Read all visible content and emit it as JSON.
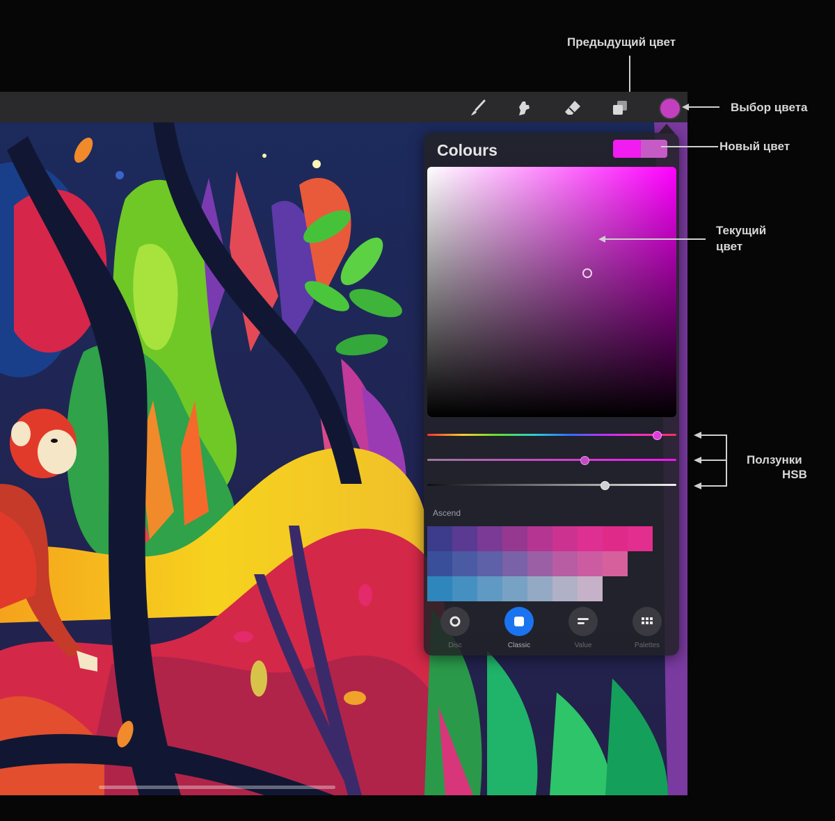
{
  "annotations": {
    "previous_color": "Предыдущий цвет",
    "color_picker": "Выбор цвета",
    "new_color": "Новый цвет",
    "current_color_line1": "Текущий",
    "current_color_line2": "цвет",
    "hsb_line1": "Ползунки",
    "hsb_line2": "HSB"
  },
  "toolbar": {
    "icons": [
      "brush-icon",
      "smudge-icon",
      "eraser-icon",
      "layers-icon"
    ],
    "current_color": "#c43fbf"
  },
  "panel": {
    "title": "Colours",
    "previous_swatch_color": "#f01cf0",
    "new_swatch_color": "#c65bc6",
    "palette_name": "Ascend",
    "palette_rows": [
      [
        "#3d3b8c",
        "#5a3a92",
        "#7a3a96",
        "#96388f",
        "#b43592",
        "#cc3390",
        "#dd3092",
        "#e02a8a",
        "#e22e8e"
      ],
      [
        "#3a4f9a",
        "#4a5ba4",
        "#5e60a8",
        "#7a62a8",
        "#9a5fa5",
        "#b85ca3",
        "#cc5ca2",
        "#d6609c"
      ],
      [
        "#2e86bd",
        "#4590c0",
        "#6099c4",
        "#78a2c4",
        "#94a9c4",
        "#b0b0c6",
        "#c6b2c8"
      ]
    ],
    "tabs": [
      {
        "label": "Disc",
        "icon": "disc-icon"
      },
      {
        "label": "Classic",
        "icon": "classic-square-icon",
        "active": true
      },
      {
        "label": "Value",
        "icon": "value-sliders-icon"
      },
      {
        "label": "Palettes",
        "icon": "palettes-grid-icon"
      }
    ],
    "hsb": {
      "hue": 0.92,
      "saturation": 0.63,
      "brightness": 0.71
    }
  }
}
